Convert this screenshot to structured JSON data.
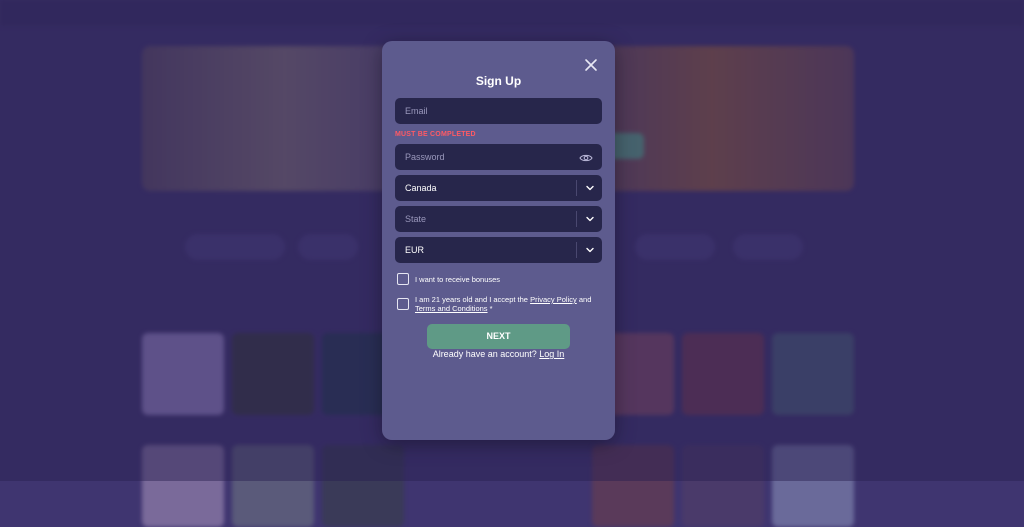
{
  "modal": {
    "title": "Sign Up",
    "email": {
      "placeholder": "Email",
      "error": "MUST BE COMPLETED"
    },
    "password": {
      "placeholder": "Password"
    },
    "country": {
      "value": "Canada"
    },
    "state": {
      "placeholder": "State"
    },
    "currency": {
      "value": "EUR"
    },
    "bonus_label": "I want to receive bonuses",
    "terms": {
      "prefix": "I am 21 years old and I accept the",
      "privacy_link": "Privacy Policy",
      "and": "and",
      "terms_link": "Terms and Conditions",
      "required_mark": "*"
    },
    "next_label": "NEXT",
    "already_text": "Already have an account?",
    "login_link": "Log In"
  },
  "colors": {
    "accent": "#5f9a86",
    "error": "#ff5a64",
    "modal_bg": "#5d5b8e",
    "field_bg": "#27264b"
  },
  "icons": [
    "close-icon",
    "eye-icon",
    "chevron-down-icon"
  ]
}
